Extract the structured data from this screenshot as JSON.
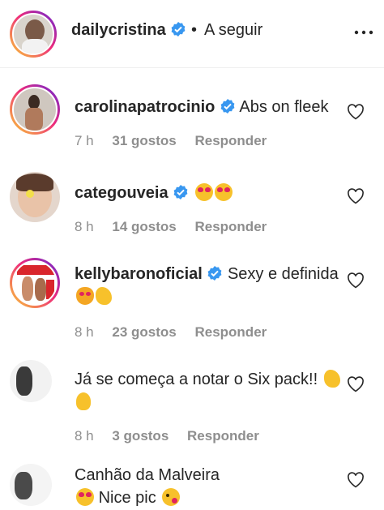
{
  "post": {
    "author": "dailycristina",
    "separator": "•",
    "follow_label": "A seguir"
  },
  "comments": [
    {
      "user": "carolinapatrocinio",
      "verified": true,
      "text": "Abs on fleek",
      "emojis": [],
      "time": "7 h",
      "likes": "31 gostos",
      "reply": "Responder"
    },
    {
      "user": "categouveia",
      "verified": true,
      "text": "",
      "emojis": [
        "heart-eyes-emoji",
        "heart-eyes-emoji"
      ],
      "time": "8 h",
      "likes": "14 gostos",
      "reply": "Responder"
    },
    {
      "user": "kellybaronoficial",
      "verified": true,
      "text": "Sexy e definida",
      "emojis": [
        "heart-eyes-cat-emoji",
        "flexed-biceps-emoji"
      ],
      "time": "8 h",
      "likes": "23 gostos",
      "reply": "Responder"
    },
    {
      "user": "",
      "verified": false,
      "text": "Já se começa a notar o Six pack!!",
      "emojis": [
        "flexed-biceps-emoji",
        "ok-hand-emoji"
      ],
      "time": "8 h",
      "likes": "3 gostos",
      "reply": "Responder"
    },
    {
      "user": "",
      "verified": false,
      "text": "Canhão da Malveira",
      "text2": "Nice pic",
      "emojis": [
        "heart-eyes-emoji",
        "wink-kiss-emoji"
      ],
      "time": "",
      "likes": "",
      "reply": ""
    }
  ],
  "colors": {
    "text": "#262626",
    "meta": "#8e8e8e",
    "verified_blue": "#3897f0",
    "divider": "#efefef"
  }
}
